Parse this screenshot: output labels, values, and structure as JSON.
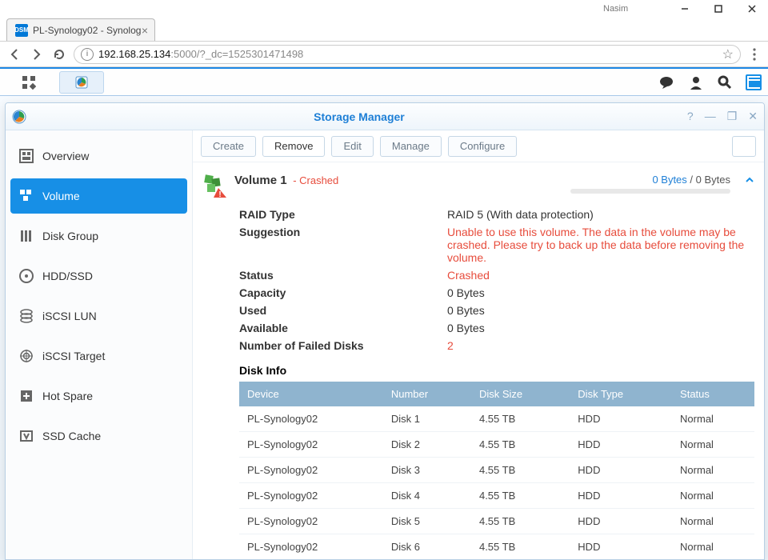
{
  "user_label": "Nasim",
  "browser": {
    "tab_title": "PL-Synology02 - Synolog",
    "tab_favicon_text": "DSM",
    "url_host": "192.168.25.134",
    "url_path": ":5000/?_dc=1525301471498"
  },
  "window": {
    "title": "Storage Manager"
  },
  "toolbar": {
    "create": "Create",
    "remove": "Remove",
    "edit": "Edit",
    "manage": "Manage",
    "configure": "Configure"
  },
  "sidebar": {
    "items": [
      {
        "label": "Overview"
      },
      {
        "label": "Volume"
      },
      {
        "label": "Disk Group"
      },
      {
        "label": "HDD/SSD"
      },
      {
        "label": "iSCSI LUN"
      },
      {
        "label": "iSCSI Target"
      },
      {
        "label": "Hot Spare"
      },
      {
        "label": "SSD Cache"
      }
    ]
  },
  "volume": {
    "name": "Volume 1",
    "state_suffix": " - Crashed",
    "used_display": "0 Bytes",
    "separator": " / ",
    "total_display": "0 Bytes",
    "props": {
      "raid_label": "RAID Type",
      "raid_value": "RAID 5 (With data protection)",
      "sugg_label": "Suggestion",
      "sugg_value": "Unable to use this volume. The data in the volume may be crashed. Please try to back up the data before removing the volume.",
      "status_label": "Status",
      "status_value": "Crashed",
      "cap_label": "Capacity",
      "cap_value": "0 Bytes",
      "used_label": "Used",
      "used_value": "0 Bytes",
      "avail_label": "Available",
      "avail_value": "0 Bytes",
      "failed_label": "Number of Failed Disks",
      "failed_value": "2"
    },
    "disk_info_label": "Disk Info",
    "disk_headers": {
      "device": "Device",
      "number": "Number",
      "size": "Disk Size",
      "type": "Disk Type",
      "status": "Status"
    },
    "disks": [
      {
        "device": "PL-Synology02",
        "number": "Disk 1",
        "size": "4.55 TB",
        "type": "HDD",
        "status": "Normal"
      },
      {
        "device": "PL-Synology02",
        "number": "Disk 2",
        "size": "4.55 TB",
        "type": "HDD",
        "status": "Normal"
      },
      {
        "device": "PL-Synology02",
        "number": "Disk 3",
        "size": "4.55 TB",
        "type": "HDD",
        "status": "Normal"
      },
      {
        "device": "PL-Synology02",
        "number": "Disk 4",
        "size": "4.55 TB",
        "type": "HDD",
        "status": "Normal"
      },
      {
        "device": "PL-Synology02",
        "number": "Disk 5",
        "size": "4.55 TB",
        "type": "HDD",
        "status": "Normal"
      },
      {
        "device": "PL-Synology02",
        "number": "Disk 6",
        "size": "4.55 TB",
        "type": "HDD",
        "status": "Normal"
      }
    ]
  }
}
